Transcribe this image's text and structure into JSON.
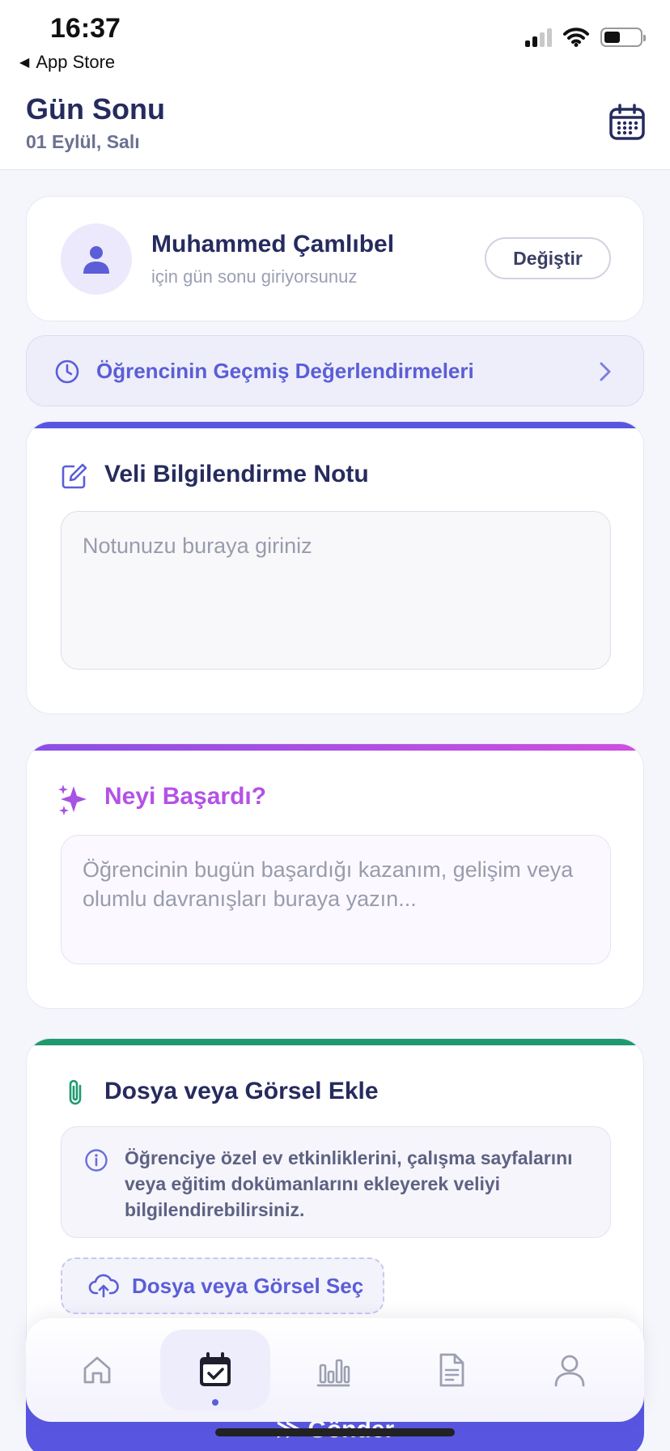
{
  "status_bar": {
    "time": "16:37",
    "back_label": "App Store"
  },
  "header": {
    "title": "Gün Sonu",
    "date": "01 Eylül, Salı"
  },
  "student": {
    "name": "Muhammed Çamlıbel",
    "subtitle": "için gün sonu giriyorsunuz",
    "change_label": "Değiştir"
  },
  "history": {
    "label": "Öğrencinin Geçmiş Değerlendirmeleri"
  },
  "note": {
    "title": "Veli Bilgilendirme Notu",
    "placeholder": "Notunuzu buraya giriniz"
  },
  "achievement": {
    "title": "Neyi Başardı?",
    "placeholder": "Öğrencinin bugün başardığı kazanım, gelişim veya olumlu davranışları buraya yazın..."
  },
  "attachment": {
    "title": "Dosya veya Görsel Ekle",
    "info": "Öğrenciye özel ev etkinliklerini, çalışma sayfalarını veya eğitim dokümanlarını ekleyerek veliyi bilgilendirebilirsiniz.",
    "upload_label": "Dosya veya Görsel Seç"
  },
  "send": {
    "label": "≫ Gönder"
  },
  "tabs": [
    {
      "icon": "home-icon",
      "active": false
    },
    {
      "icon": "calendar-check-icon",
      "active": true
    },
    {
      "icon": "bar-chart-icon",
      "active": false
    },
    {
      "icon": "document-icon",
      "active": false
    },
    {
      "icon": "profile-icon",
      "active": false
    }
  ],
  "colors": {
    "primary": "#5b5ed6",
    "note_accent": "#5856e0",
    "achievement_accent": "#b451e6",
    "attachment_accent": "#1f9a6e",
    "title_text": "#262b5e"
  }
}
